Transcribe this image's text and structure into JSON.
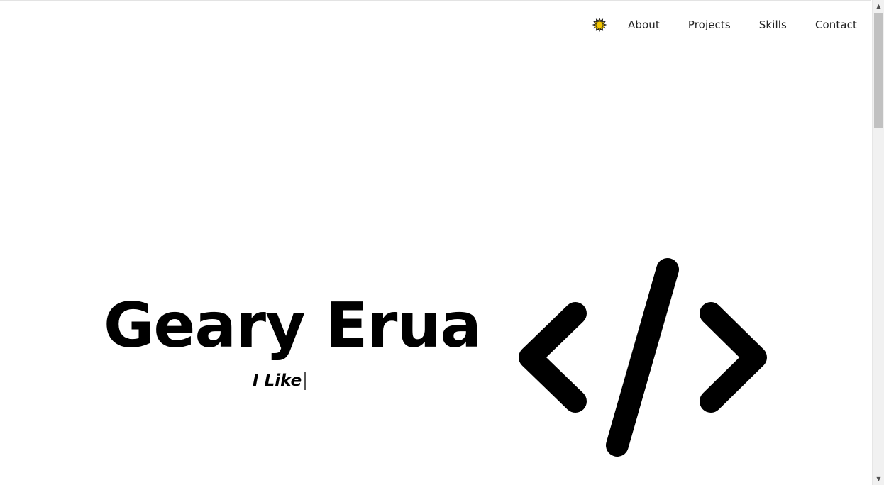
{
  "nav": {
    "theme_icon": "sun-icon",
    "items": [
      {
        "label": "About"
      },
      {
        "label": "Projects"
      },
      {
        "label": "Skills"
      },
      {
        "label": "Contact"
      }
    ]
  },
  "hero": {
    "name": "Geary Erua",
    "tagline_prefix": "I Like",
    "illustration_icon": "code-brackets-icon"
  },
  "colors": {
    "background": "#ffffff",
    "text": "#000000",
    "sun": "#f5c800"
  }
}
